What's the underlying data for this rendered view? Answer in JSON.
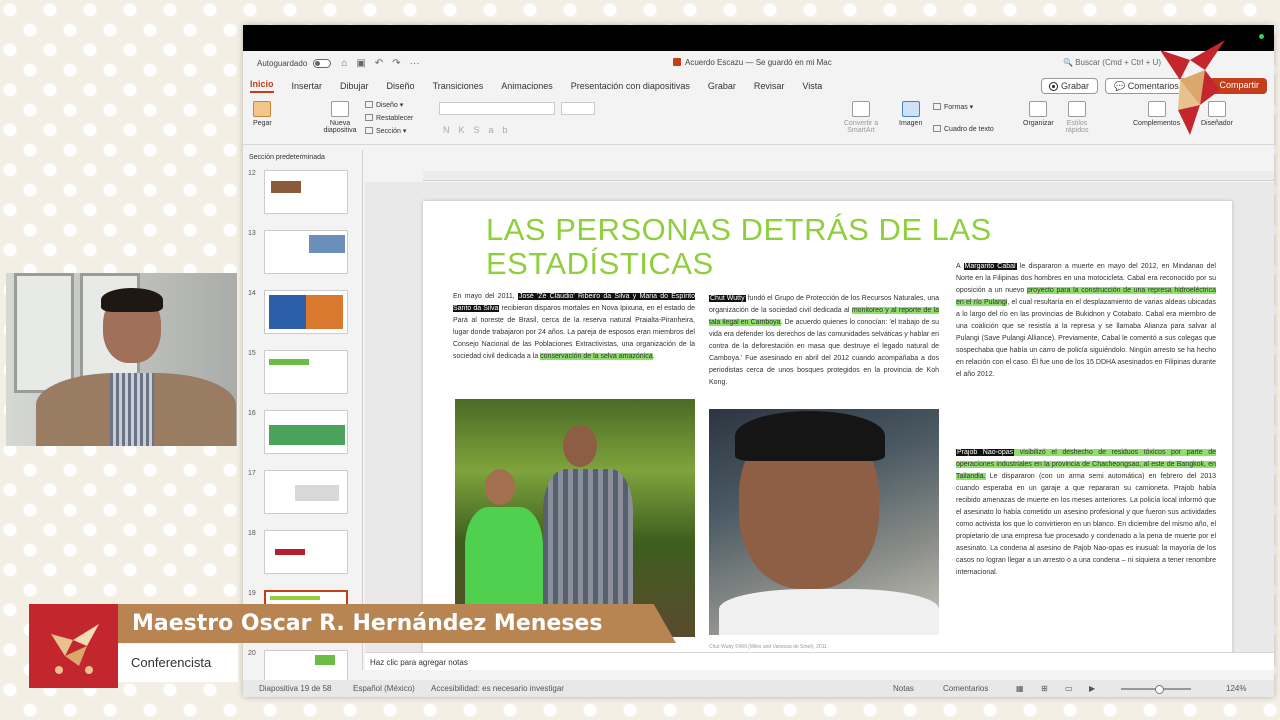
{
  "app": {
    "autosave_label": "Autoguardado",
    "doc_title": "Acuerdo Escazu — Se guardó en mi Mac",
    "search_placeholder": "Buscar (Cmd + Ctrl + U)",
    "tabs": [
      "Inicio",
      "Insertar",
      "Dibujar",
      "Diseño",
      "Transiciones",
      "Animaciones",
      "Presentación con diapositivas",
      "Grabar",
      "Revisar",
      "Vista"
    ],
    "record_label": "Grabar",
    "comments_label": "Comentarios",
    "share_label": "Compartir"
  },
  "ribbon": {
    "paste": "Pegar",
    "new_slide": "Nueva diapositiva",
    "layout": "Diseño",
    "reset": "Restablecer",
    "section": "Sección",
    "smartart": "Convertir a SmartArt",
    "image": "Imagen",
    "shapes": "Formas",
    "textbox": "Cuadro de texto",
    "arrange": "Organizar",
    "quick_styles": "Estilos rápidos",
    "addins": "Complementos",
    "designer": "Diseñador"
  },
  "panel": {
    "section_title": "Sección predeterminada",
    "slides": [
      "12",
      "13",
      "14",
      "15",
      "16",
      "17",
      "18",
      "19",
      "20"
    ]
  },
  "slide": {
    "title": "LAS PERSONAS DETRÁS DE LAS ESTADÍSTICAS",
    "col1": {
      "pre": "En mayo del 2011, ",
      "names": "José 'Zé Cláudio' Ribeiro da Silva y Maria do Espírito Santo da Silva",
      "mid": " recibieron disparos mortales en Nova Ipixuna, en el estado de Pará al noreste de Brasil, cerca de la reserva natural Praialta-Piranheira, lugar donde trabajaron por 24 años. La pareja de esposos eran miembros del Consejo Nacional de las Poblaciones Extractivistas, una organización de la sociedad civil dedicada a la ",
      "green": "conservación de la selva amazónica",
      "post": "."
    },
    "col2": {
      "name": "Chut Wutty",
      "a": " fundó el Grupo de Protección de los Recursos Naturales, una organización de la sociedad civil dedicada al ",
      "green": "monitoreo y al reporte de la tala ilegal en Camboya",
      "b": ". De acuerdo quienes lo conocían: 'el trabajo de su vida era defender los derechos de las comunidades selváticas y hablar en contra de la deforestación en masa que destruye el legado natural de Camboya.' Fue asesinado en abril del 2012 cuando acompañaba a dos periodistas cerca de unos bosques protegidos en la provincia de Koh Kong."
    },
    "col3a": {
      "pre": "A ",
      "name": "Margarito Cabal",
      "a": " le dispararon a muerte en mayo del 2012, en Mindanao del Norte en la Filipinas dos hombres en una motocicleta. Cabal era reconocido por su oposición a un nuevo ",
      "green": "proyecto para la construcción de una represa hidroeléctrica en el río Pulangi",
      "b": ", el cual resultaría en el desplazamiento de varias aldeas ubicadas a lo largo del río en las provincias de Bukidnon y Cotabato. Cabal era miembro de una coalición que se resistía a la represa y se llamaba Alianza para salvar al Pulangi (Save Pulangi Alliance). Previamente, Cabal le comentó a sus colegas que sospechaba que había un carro de policía siguiéndolo. Ningún arresto se ha hecho en relación con el caso. Él fue uno de los 15 DDHA asesinados en Filipinas durante el año 2012."
    },
    "col3b": {
      "name": "Prajob Nao-opas",
      "green": " visibilizó el deshecho de residuos tóxicos por parte de operaciones industriales en la provincia de Chacheongsao, al este de Bangkok, en Tailandia.",
      "b": " Le dispararon (con un arma semi automática) en febrero del 2013 cuando esperaba en un garaje a que repararan su camioneta. Prajob había recibido amenazas de muerte en los meses anteriores. La policía local informó que el asesinato lo había cometido un asesino profesional y que fueron sus actividades como activista los que lo convirtieron en un blanco. En diciembre del mismo año, el propietario de una empresa fue procesado y condenado a la pena de muerte por el asesinato. La condena al asesino de Pajob Nao-opas es inusual: la mayoría de los casos no logran llegar a un arresto o a una condena – ni siquiera a tener renombre internacional."
    },
    "caption2": "Chut Wutty ©Will (Miles and Vanessa de Smet), 2011"
  },
  "notes_placeholder": "Haz clic para agregar notas",
  "status": {
    "slide_of": "Diapositiva 19 de 58",
    "language": "Español (México)",
    "accessibility": "Accesibilidad: es necesario investigar",
    "notes": "Notas",
    "comments": "Comentarios",
    "zoom": "124%"
  },
  "lower_third": {
    "name": "Maestro Oscar R. Hernández Meneses",
    "role": "Conferencista"
  },
  "colors": {
    "accent": "#c43e1c",
    "title_green": "#8fcf3c",
    "highlight_green": "#8ee06a",
    "lower_third_red": "#c4262e",
    "lower_third_gold": "#b88452"
  }
}
